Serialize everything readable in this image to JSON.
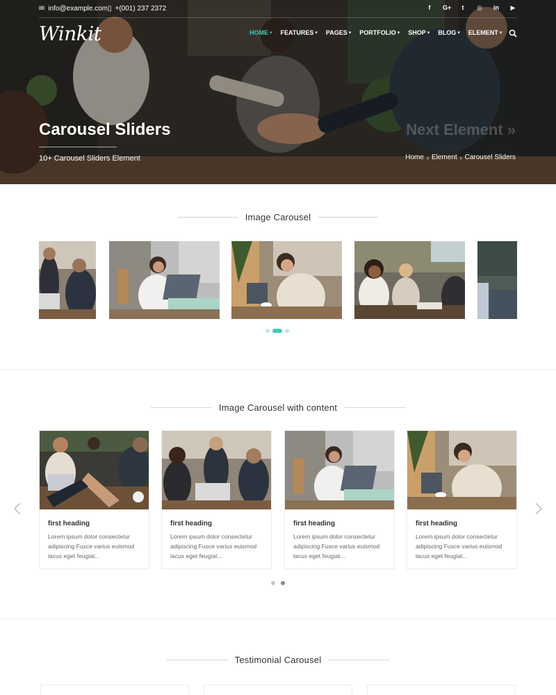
{
  "topbar": {
    "email": "info@example.com",
    "phone": "+(001) 237 2372",
    "socials": [
      "facebook-icon",
      "google-plus-icon",
      "twitter-icon",
      "instagram-icon",
      "linkedin-icon",
      "youtube-icon"
    ],
    "social_glyphs": [
      "f",
      "G+",
      "t",
      "◎",
      "in",
      "▶"
    ]
  },
  "logo": "Winkit",
  "nav": {
    "items": [
      {
        "label": "HOME",
        "active": true
      },
      {
        "label": "FEATURES"
      },
      {
        "label": "PAGES"
      },
      {
        "label": "PORTFOLIO"
      },
      {
        "label": "SHOP"
      },
      {
        "label": "BLOG"
      },
      {
        "label": "ELEMENT"
      }
    ]
  },
  "hero": {
    "title": "Carousel Sliders",
    "subtitle": "10+ Carousel Sliders Element",
    "next_label": "Next Element »",
    "breadcrumb": [
      "Home",
      "Element",
      "Carousel Sliders"
    ]
  },
  "sections": {
    "image_carousel": "Image Carousel",
    "content_carousel": "Image Carousel with content",
    "testimonial": "Testimonial Carousel"
  },
  "content_cards": [
    {
      "title": "first heading",
      "text": "Lorem ipsum dolor consectetur adipiscing Fusce varius euismod lacus eget feugiat..."
    },
    {
      "title": "first heading",
      "text": "Lorem ipsum dolor consectetur adipiscing Fusce varius euismod lacus eget feugiat..."
    },
    {
      "title": "first heading",
      "text": "Lorem ipsum dolor consectetur adipiscing Fusce varius euismod lacus eget feugiat..."
    },
    {
      "title": "first heading",
      "text": "Lorem ipsum dolor consectetur adipiscing Fusce varius euismod lacus eget feugiat..."
    }
  ],
  "carousel1_dots": {
    "count": 3,
    "active": 1
  },
  "carousel2_dots": {
    "count": 2,
    "active": 1
  },
  "colors": {
    "accent": "#3fcfb4"
  }
}
